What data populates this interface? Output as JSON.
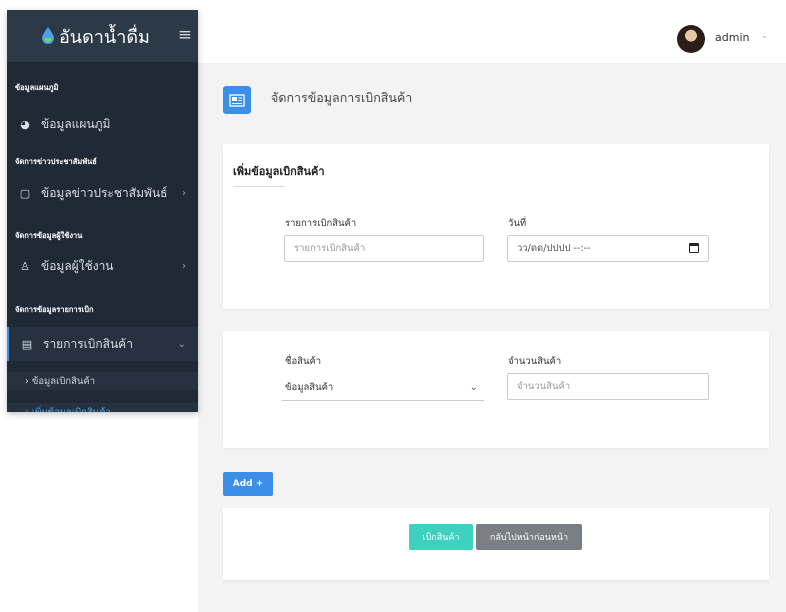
{
  "sidebar": {
    "brand": "อันดาน้ำดื่ม",
    "menu_icon": "hamburger-icon",
    "sections": {
      "map": "ข้อมูลแผนภูมิ",
      "news": "จัดการข่าวประชาสัมพันธ์",
      "users": "จัดการข้อมูลผู้ใช้งาน",
      "withdraw": "จัดการข้อมูลรายการเบิก"
    },
    "items": {
      "map": "ข้อมูลแผนภูมิ",
      "news": "ข้อมูลข่าวประชาสัมพันธ์",
      "users": "ข้อมูลผู้ใช้งาน",
      "withdraw": "รายการเบิกสินค้า"
    },
    "sub_items": {
      "data": "› ข้อมูลเบิกสินค้า",
      "add": "› เพิ่มข้อมูลเบิกสินค้า"
    }
  },
  "topbar": {
    "user": "admin"
  },
  "page": {
    "title": "จัดการข้อมูลการเบิกสินค้า"
  },
  "form": {
    "card_title": "เพิ่มข้อมูลเบิกสินค้า",
    "item_label": "รายการเบิกสินค้า",
    "item_placeholder": "รายการเบิกสินค้า",
    "date_label": "วันที่",
    "date_placeholder": "วว/ดด/ปปปป --:--",
    "product_label": "ชื่อสินค้า",
    "product_selected": "ข้อมูลสินค้า",
    "qty_label": "จำนวนสินค้า",
    "qty_placeholder": "จำนวนสินค้า"
  },
  "buttons": {
    "add": "Add +",
    "submit": "เบิกสินค้า",
    "back": "กลับไปหน้าก่อนหน้า"
  },
  "colors": {
    "sidebar_bg": "#1f2a36",
    "accent": "#3b8fe6",
    "submit": "#3ed1c0",
    "back": "#7a7f85"
  }
}
